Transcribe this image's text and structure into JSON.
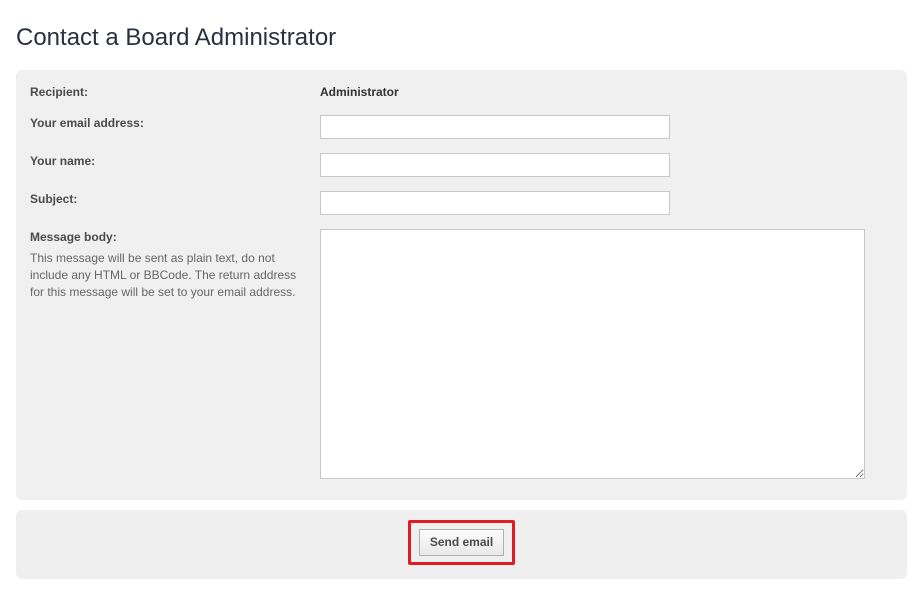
{
  "page": {
    "title": "Contact a Board Administrator"
  },
  "form": {
    "recipient_label": "Recipient:",
    "recipient_value": "Administrator",
    "email_label": "Your email address:",
    "email_value": "",
    "name_label": "Your name:",
    "name_value": "",
    "subject_label": "Subject:",
    "subject_value": "",
    "body_label": "Message body:",
    "body_hint": "This message will be sent as plain text, do not include any HTML or BBCode. The return address for this message will be set to your email address.",
    "body_value": "",
    "submit_label": "Send email"
  }
}
